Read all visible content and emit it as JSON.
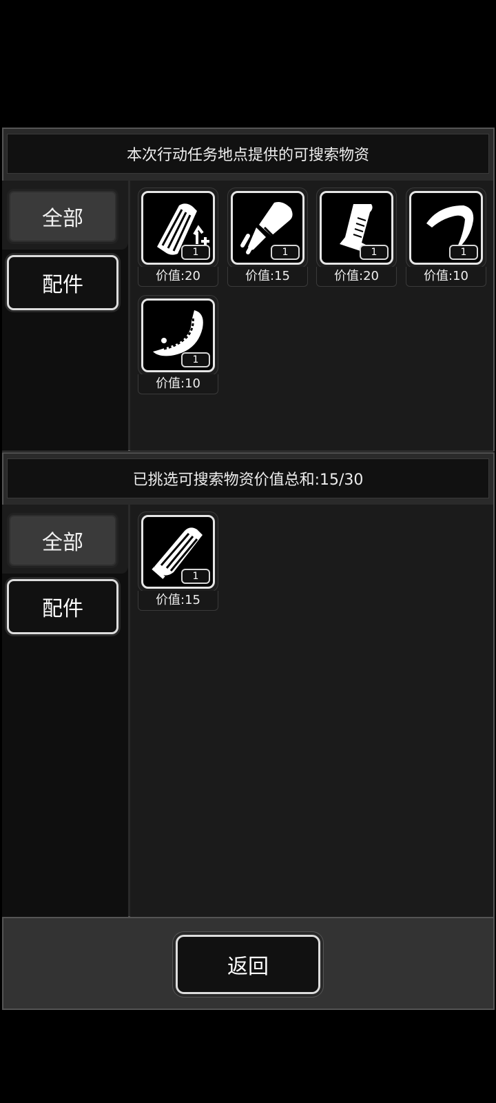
{
  "top_section": {
    "title": "本次行动任务地点提供的可搜索物资",
    "tabs": {
      "all": "全部",
      "parts": "配件"
    },
    "items": [
      {
        "icon": "magazine-extended-icon",
        "qty": "1",
        "value": "价值:20"
      },
      {
        "icon": "flashlight-icon",
        "qty": "1",
        "value": "价值:15"
      },
      {
        "icon": "pistol-grip-icon",
        "qty": "1",
        "value": "价值:20"
      },
      {
        "icon": "hook-icon",
        "qty": "1",
        "value": "价值:10"
      },
      {
        "icon": "curved-blade-icon",
        "qty": "1",
        "value": "价值:10"
      }
    ]
  },
  "bottom_section": {
    "title": "已挑选可搜索物资价值总和:15/30",
    "tabs": {
      "all": "全部",
      "parts": "配件"
    },
    "items": [
      {
        "icon": "magazine-icon",
        "qty": "1",
        "value": "价值:15"
      }
    ]
  },
  "footer": {
    "return_label": "返回"
  }
}
